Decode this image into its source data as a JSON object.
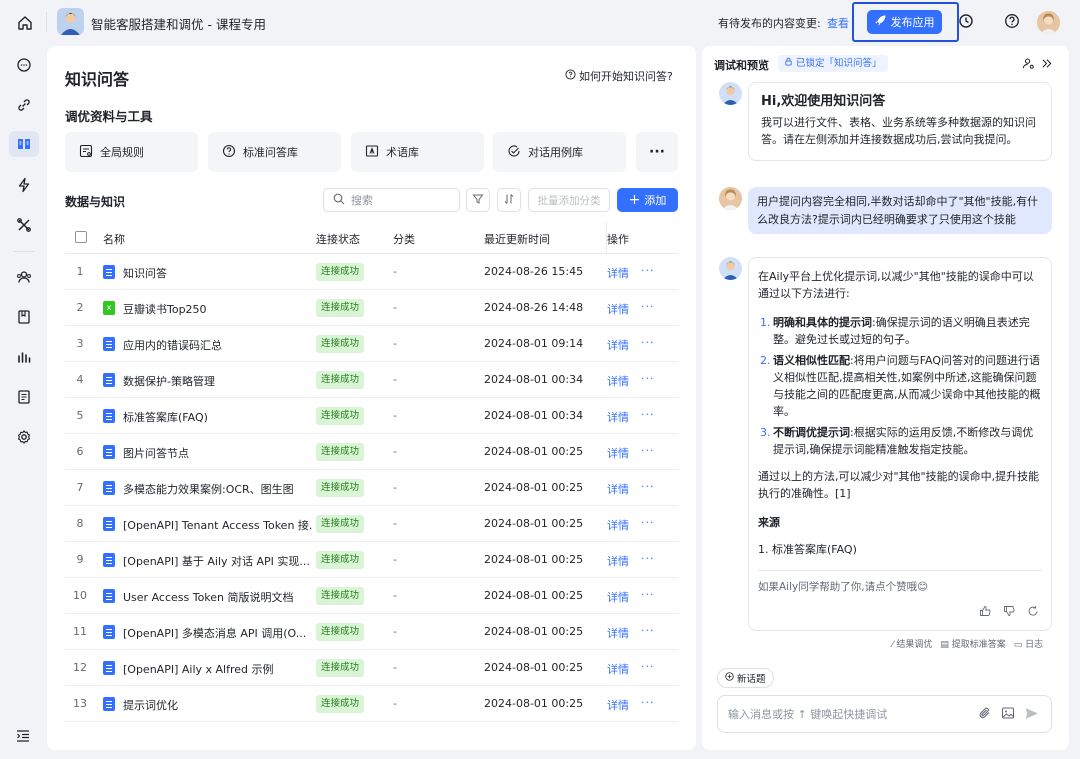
{
  "header": {
    "app_title": "智能客服搭建和调优 - 课程专用",
    "pending_text": "有待发布的内容变更:",
    "view_link": "查看",
    "publish_button": "发布应用"
  },
  "left_panel": {
    "title": "知识问答",
    "howto_link": "如何开始知识问答?",
    "tools_section": "调优资料与工具",
    "tools": [
      "全局规则",
      "标准问答库",
      "术语库",
      "对话用例库"
    ],
    "tools_more": "···",
    "data_section": "数据与知识",
    "search_placeholder": "搜索",
    "batch_button": "批量添加分类",
    "add_button": "添加",
    "columns": {
      "name": "名称",
      "status": "连接状态",
      "category": "分类",
      "updated": "最近更新时间",
      "ops": "操作"
    },
    "rows": [
      {
        "idx": "1",
        "type": "doc",
        "name": "知识问答",
        "status": "连接成功",
        "category": "-",
        "updated": "2024-08-26 15:45",
        "op": "详情",
        "more": "···"
      },
      {
        "idx": "2",
        "type": "sheet",
        "name": "豆瓣读书Top250",
        "status": "连接成功",
        "category": "-",
        "updated": "2024-08-26 14:48",
        "op": "详情",
        "more": "···"
      },
      {
        "idx": "3",
        "type": "doc",
        "name": "应用内的错误码汇总",
        "status": "连接成功",
        "category": "-",
        "updated": "2024-08-01 09:14",
        "op": "详情",
        "more": "···"
      },
      {
        "idx": "4",
        "type": "doc",
        "name": "数据保护-策略管理",
        "status": "连接成功",
        "category": "-",
        "updated": "2024-08-01 00:34",
        "op": "详情",
        "more": "···"
      },
      {
        "idx": "5",
        "type": "doc",
        "name": "标准答案库(FAQ)",
        "status": "连接成功",
        "category": "-",
        "updated": "2024-08-01 00:34",
        "op": "详情",
        "more": "···"
      },
      {
        "idx": "6",
        "type": "doc",
        "name": "图片问答节点",
        "status": "连接成功",
        "category": "-",
        "updated": "2024-08-01 00:25",
        "op": "详情",
        "more": "···"
      },
      {
        "idx": "7",
        "type": "doc",
        "name": "多模态能力效果案例:OCR、图生图",
        "status": "连接成功",
        "category": "-",
        "updated": "2024-08-01 00:25",
        "op": "详情",
        "more": "···"
      },
      {
        "idx": "8",
        "type": "doc",
        "name": "[OpenAPI] Tenant Access Token 接...",
        "status": "连接成功",
        "category": "-",
        "updated": "2024-08-01 00:25",
        "op": "详情",
        "more": "···"
      },
      {
        "idx": "9",
        "type": "doc",
        "name": "[OpenAPI] 基于 Aily 对话 API 实现...",
        "status": "连接成功",
        "category": "-",
        "updated": "2024-08-01 00:25",
        "op": "详情",
        "more": "···"
      },
      {
        "idx": "10",
        "type": "doc",
        "name": "User Access Token 简版说明文档",
        "status": "连接成功",
        "category": "-",
        "updated": "2024-08-01 00:25",
        "op": "详情",
        "more": "···"
      },
      {
        "idx": "11",
        "type": "doc",
        "name": "[OpenAPI] 多模态消息 API 调用(O...",
        "status": "连接成功",
        "category": "-",
        "updated": "2024-08-01 00:25",
        "op": "详情",
        "more": "···"
      },
      {
        "idx": "12",
        "type": "doc",
        "name": "[OpenAPI] Aily x Alfred 示例",
        "status": "连接成功",
        "category": "-",
        "updated": "2024-08-01 00:25",
        "op": "详情",
        "more": "···"
      },
      {
        "idx": "13",
        "type": "doc",
        "name": "提示词优化",
        "status": "连接成功",
        "category": "-",
        "updated": "2024-08-01 00:25",
        "op": "详情",
        "more": "···"
      }
    ]
  },
  "right_panel": {
    "title": "调试和预览",
    "locked_tag": "已锁定「知识问答」",
    "welcome_title": "Hi,欢迎使用知识问答",
    "welcome_body": "我可以进行文件、表格、业务系统等多种数据源的知识问答。请在左侧添加并连接数据成功后,尝试向我提问。",
    "user_message": "用户提问内容完全相同,半数对话却命中了\"其他\"技能,有什么改良方法?提示词内已经明确要求了只使用这个技能",
    "answer_intro": "在Aily平台上优化提示词,以减少\"其他\"技能的误命中可以通过以下方法进行:",
    "answer_items": [
      {
        "n": "1.",
        "bold": "明确和具体的提示词",
        "text": ":确保提示词的语义明确且表述完整。避免过长或过短的句子。"
      },
      {
        "n": "2.",
        "bold": "语义相似性匹配",
        "text": ":将用户问题与FAQ问答对的问题进行语义相似性匹配,提高相关性,如案例中所述,这能确保问题与技能之间的匹配度更高,从而减少误命中其他技能的概率。"
      },
      {
        "n": "3.",
        "bold": "不断调优提示词",
        "text": ":根据实际的运用反馈,不断修改与调优提示词,确保提示词能精准触发指定技能。"
      }
    ],
    "answer_summary": "通过以上的方法,可以减少对\"其他\"技能的误命中,提升技能执行的准确性。[1]",
    "source_title": "来源",
    "source_item": "1. 标准答案库(FAQ)",
    "like_prompt": "如果Aily同学帮助了你,请点个赞哦😊",
    "footer_links": [
      "结果调优",
      "提取标准答案",
      "日志"
    ],
    "new_topic": "新话题",
    "input_placeholder": "输入消息或按 ↑ 键唤起快捷调试"
  },
  "colors": {
    "primary": "#3370ff",
    "success_bg": "#d9f5d6",
    "success_text": "#237b19",
    "user_bubble": "#dfe8fd"
  }
}
